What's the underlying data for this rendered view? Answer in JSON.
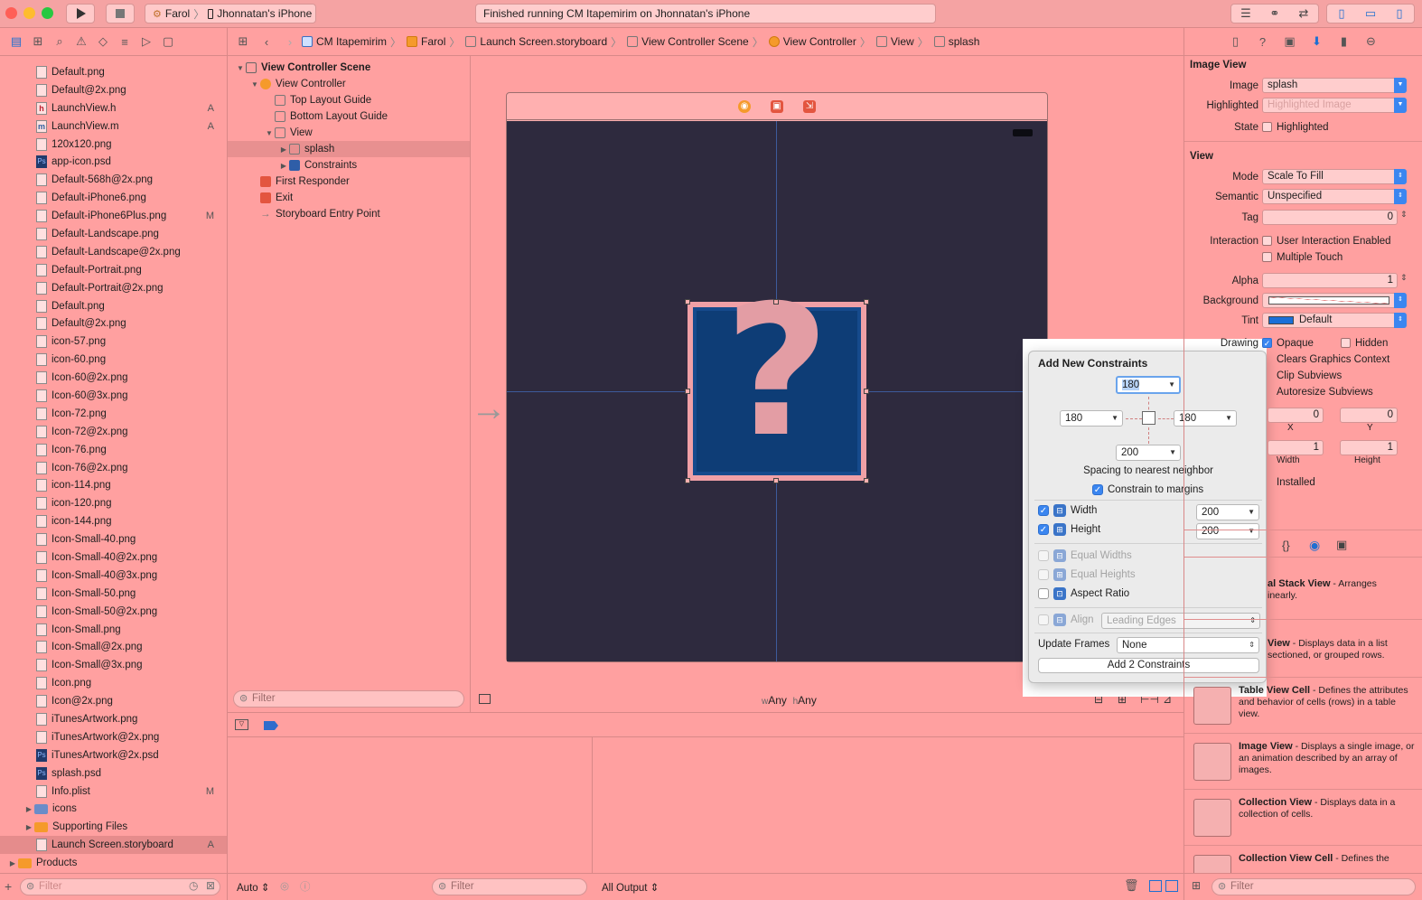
{
  "toolbar": {
    "scheme": "Farol",
    "device": "Jhonnatan's iPhone",
    "status": "Finished running CM Itapemirim on Jhonnatan's iPhone"
  },
  "navigator": {
    "files": [
      {
        "name": "Default.png",
        "icon": "png"
      },
      {
        "name": "Default@2x.png",
        "icon": "png"
      },
      {
        "name": "LaunchView.h",
        "icon": "h",
        "badge": "A"
      },
      {
        "name": "LaunchView.m",
        "icon": "m",
        "badge": "A"
      },
      {
        "name": "120x120.png",
        "icon": "png"
      },
      {
        "name": "app-icon.psd",
        "icon": "psd"
      },
      {
        "name": "Default-568h@2x.png",
        "icon": "png"
      },
      {
        "name": "Default-iPhone6.png",
        "icon": "png"
      },
      {
        "name": "Default-iPhone6Plus.png",
        "icon": "png",
        "badge": "M"
      },
      {
        "name": "Default-Landscape.png",
        "icon": "png"
      },
      {
        "name": "Default-Landscape@2x.png",
        "icon": "png"
      },
      {
        "name": "Default-Portrait.png",
        "icon": "png"
      },
      {
        "name": "Default-Portrait@2x.png",
        "icon": "png"
      },
      {
        "name": "Default.png",
        "icon": "png"
      },
      {
        "name": "Default@2x.png",
        "icon": "png"
      },
      {
        "name": "icon-57.png",
        "icon": "png"
      },
      {
        "name": "icon-60.png",
        "icon": "png"
      },
      {
        "name": "Icon-60@2x.png",
        "icon": "png"
      },
      {
        "name": "Icon-60@3x.png",
        "icon": "png"
      },
      {
        "name": "Icon-72.png",
        "icon": "png"
      },
      {
        "name": "Icon-72@2x.png",
        "icon": "png"
      },
      {
        "name": "Icon-76.png",
        "icon": "png"
      },
      {
        "name": "Icon-76@2x.png",
        "icon": "png"
      },
      {
        "name": "icon-114.png",
        "icon": "png"
      },
      {
        "name": "icon-120.png",
        "icon": "png"
      },
      {
        "name": "icon-144.png",
        "icon": "png"
      },
      {
        "name": "Icon-Small-40.png",
        "icon": "png"
      },
      {
        "name": "Icon-Small-40@2x.png",
        "icon": "png"
      },
      {
        "name": "Icon-Small-40@3x.png",
        "icon": "png"
      },
      {
        "name": "Icon-Small-50.png",
        "icon": "png"
      },
      {
        "name": "Icon-Small-50@2x.png",
        "icon": "png"
      },
      {
        "name": "Icon-Small.png",
        "icon": "png"
      },
      {
        "name": "Icon-Small@2x.png",
        "icon": "png"
      },
      {
        "name": "Icon-Small@3x.png",
        "icon": "png"
      },
      {
        "name": "Icon.png",
        "icon": "png"
      },
      {
        "name": "Icon@2x.png",
        "icon": "png"
      },
      {
        "name": "iTunesArtwork.png",
        "icon": "png"
      },
      {
        "name": "iTunesArtwork@2x.png",
        "icon": "png"
      },
      {
        "name": "iTunesArtwork@2x.psd",
        "icon": "psd"
      },
      {
        "name": "splash.psd",
        "icon": "psd"
      },
      {
        "name": "Info.plist",
        "icon": "plist",
        "badge": "M"
      },
      {
        "name": "icons",
        "icon": "folder-blue",
        "disclosure": true
      },
      {
        "name": "Supporting Files",
        "icon": "folder",
        "disclosure": true
      },
      {
        "name": "Launch Screen.storyboard",
        "icon": "storyboard",
        "badge": "A",
        "selected": true
      },
      {
        "name": "Products",
        "icon": "folder",
        "disclosure": true,
        "outdent": true
      }
    ],
    "filter_placeholder": "Filter"
  },
  "jumpbar": {
    "crumbs": [
      "CM Itapemirim",
      "Farol",
      "Launch Screen.storyboard",
      "View Controller Scene",
      "View Controller",
      "View",
      "splash"
    ]
  },
  "outline": {
    "scene": "View Controller Scene",
    "view_controller": "View Controller",
    "top_guide": "Top Layout Guide",
    "bottom_guide": "Bottom Layout Guide",
    "view": "View",
    "splash": "splash",
    "constraints": "Constraints",
    "first_responder": "First Responder",
    "exit": "Exit",
    "entry_point": "Storyboard Entry Point",
    "filter_placeholder": "Filter"
  },
  "canvas": {
    "size_w_prefix": "w",
    "size_w": "Any",
    "size_h_prefix": "h",
    "size_h": "Any",
    "image_glyph": "?"
  },
  "popover": {
    "title": "Add New Constraints",
    "top_value": "180",
    "left_value": "180",
    "right_value": "180",
    "bottom_value": "200",
    "spacing_label": "Spacing to nearest neighbor",
    "constrain_margins": "Constrain to margins",
    "width_label": "Width",
    "width_value": "200",
    "height_label": "Height",
    "height_value": "200",
    "equal_widths": "Equal Widths",
    "equal_heights": "Equal Heights",
    "aspect_ratio": "Aspect Ratio",
    "align_label": "Align",
    "align_value": "Leading Edges",
    "update_frames_label": "Update Frames",
    "update_frames_value": "None",
    "add_button": "Add 2 Constraints"
  },
  "inspector": {
    "image_view_title": "Image View",
    "image_label": "Image",
    "image_value": "splash",
    "highlighted_label": "Highlighted",
    "highlighted_placeholder": "Highlighted Image",
    "state_label": "State",
    "state_value": "Highlighted",
    "view_title": "View",
    "mode_label": "Mode",
    "mode_value": "Scale To Fill",
    "semantic_label": "Semantic",
    "semantic_value": "Unspecified",
    "tag_label": "Tag",
    "tag_value": "0",
    "interaction_label": "Interaction",
    "user_interaction": "User Interaction Enabled",
    "multiple_touch": "Multiple Touch",
    "alpha_label": "Alpha",
    "alpha_value": "1",
    "background_label": "Background",
    "tint_label": "Tint",
    "tint_value": "Default",
    "drawing_label": "Drawing",
    "opaque": "Opaque",
    "hidden": "Hidden",
    "clears_graphics": "Clears Graphics Context",
    "clip_subviews": "Clip Subviews",
    "autoresize": "Autoresize Subviews",
    "x_value": "0",
    "y_value": "0",
    "x_label": "X",
    "y_label": "Y",
    "width_value": "1",
    "height_value": "1",
    "width_label": "Width",
    "height_label": "Height",
    "installed": "Installed",
    "library": [
      {
        "title": "al Stack View",
        "desc": " - Arranges",
        "desc2": "inearly."
      },
      {
        "title": "View",
        "desc": " - Displays data in a list",
        "desc2": "sectioned, or grouped rows."
      },
      {
        "title": "Table View Cell",
        "desc": " - Defines the attributes and behavior of cells (rows) in a table view."
      },
      {
        "title": "Image View",
        "desc": " - Displays a single image, or an animation described by an array of images."
      },
      {
        "title": "Collection View",
        "desc": " - Displays data in a collection of cells."
      },
      {
        "title": "Collection View Cell",
        "desc": " - Defines the"
      }
    ],
    "filter_placeholder": "Filter"
  },
  "debug": {
    "auto": "Auto",
    "filter_placeholder": "Filter",
    "output": "All Output"
  },
  "colors": {
    "accent": "#3b86f0",
    "canvas_bg": "#2e2a3e",
    "splash_blue": "#0e3d76",
    "chrome_tint": "#ffa0a0"
  }
}
